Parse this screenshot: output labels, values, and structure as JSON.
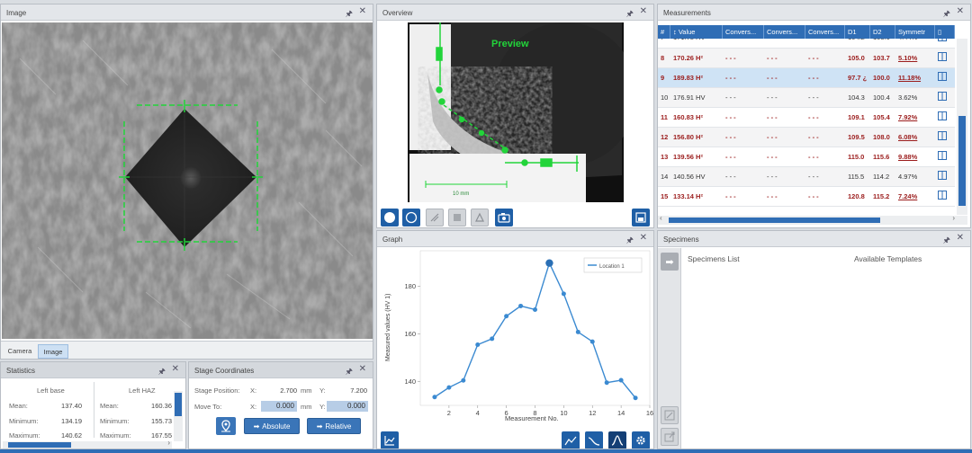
{
  "image_panel": {
    "title": "Image",
    "tabs": [
      "Camera",
      "Image"
    ],
    "active_tab": "Image"
  },
  "overview_panel": {
    "title": "Overview",
    "preview_label": "Preview",
    "scale_label": "10 mm"
  },
  "measurements_panel": {
    "title": "Measurements",
    "columns": [
      "#",
      "Value",
      "Convers...",
      "Convers...",
      "Convers...",
      "D1",
      "D2",
      "Symmetr"
    ],
    "rows": [
      {
        "n": "7",
        "value": "171.78 HV",
        "c1": "- - -",
        "c2": "- - -",
        "c3": "- - -",
        "d1": "104.2",
        "d2": "103.6",
        "sym": "4.44%",
        "fail": false
      },
      {
        "n": "8",
        "value": "170.26 H²",
        "c1": "- - -",
        "c2": "- - -",
        "c3": "- - -",
        "d1": "105.0",
        "d2": "103.7",
        "sym": "5.10%",
        "fail": true
      },
      {
        "n": "9",
        "value": "189.83 H²",
        "c1": "- - -",
        "c2": "- - -",
        "c3": "- - -",
        "d1": "97.7 ¿",
        "d2": "100.0",
        "sym": "11.18%",
        "fail": true,
        "selected": true
      },
      {
        "n": "10",
        "value": "176.91 HV",
        "c1": "- - -",
        "c2": "- - -",
        "c3": "- - -",
        "d1": "104.3",
        "d2": "100.4",
        "sym": "3.62%",
        "fail": false
      },
      {
        "n": "11",
        "value": "160.83 H²",
        "c1": "- - -",
        "c2": "- - -",
        "c3": "- - -",
        "d1": "109.1",
        "d2": "105.4",
        "sym": "7.92%",
        "fail": true
      },
      {
        "n": "12",
        "value": "156.80 H²",
        "c1": "- - -",
        "c2": "- - -",
        "c3": "- - -",
        "d1": "109.5",
        "d2": "108.0",
        "sym": "6.08%",
        "fail": true
      },
      {
        "n": "13",
        "value": "139.56 H²",
        "c1": "- - -",
        "c2": "- - -",
        "c3": "- - -",
        "d1": "115.0",
        "d2": "115.6",
        "sym": "9.88%",
        "fail": true
      },
      {
        "n": "14",
        "value": "140.56 HV",
        "c1": "- - -",
        "c2": "- - -",
        "c3": "- - -",
        "d1": "115.5",
        "d2": "114.2",
        "sym": "4.97%",
        "fail": false
      },
      {
        "n": "15",
        "value": "133.14 H²",
        "c1": "- - -",
        "c2": "- - -",
        "c3": "- - -",
        "d1": "120.8",
        "d2": "115.2",
        "sym": "7.24%",
        "fail": true
      }
    ]
  },
  "graph_panel": {
    "title": "Graph"
  },
  "chart_data": {
    "type": "line",
    "x": [
      1,
      2,
      3,
      4,
      5,
      6,
      7,
      8,
      9,
      10,
      11,
      12,
      13,
      14,
      15
    ],
    "series": [
      {
        "name": "Location 1",
        "values": [
          133.5,
          137.5,
          140.5,
          155.5,
          158,
          167.5,
          171.78,
          170.26,
          189.83,
          176.91,
          160.83,
          156.8,
          139.56,
          140.56,
          133.14
        ]
      }
    ],
    "highlight_index": 8,
    "xlabel": "Measurement No.",
    "ylabel": "Measured values (HV 1)",
    "xlim": [
      0,
      16
    ],
    "ylim": [
      130,
      195
    ],
    "xticks": [
      "2",
      "4",
      "6",
      "8",
      "10",
      "12",
      "14",
      "16"
    ],
    "yticks": [
      "140",
      "160",
      "180"
    ],
    "color": "#3b8ad1",
    "grid": false,
    "legend_position": "top-right"
  },
  "specimens_panel": {
    "title": "Specimens",
    "list_label": "Specimens List",
    "templates_label": "Available Templates"
  },
  "statistics_panel": {
    "title": "Statistics",
    "col1_header": "Left base",
    "col2_header": "Left HAZ",
    "rows": [
      {
        "label": "Mean:",
        "v1": "137.40",
        "v2": "160.36"
      },
      {
        "label": "Minimum:",
        "v1": "134.19",
        "v2": "155.73"
      },
      {
        "label": "Maximum:",
        "v1": "140.62",
        "v2": "167.55"
      }
    ]
  },
  "stage_panel": {
    "title": "Stage Coordinates",
    "position_label": "Stage Position:",
    "move_label": "Move To:",
    "x_label": "X:",
    "y_label": "Y:",
    "pos_x": "2.700",
    "pos_y": "7.200",
    "unit": "mm",
    "move_x": "0.000",
    "move_y": "0.000",
    "absolute_label": "Absolute",
    "relative_label": "Relative"
  },
  "colors": {
    "accent": "#1f5fa6",
    "header_blue": "#2f6db5",
    "fail_red": "#9b1c1c",
    "marker_green": "#22d43a"
  }
}
